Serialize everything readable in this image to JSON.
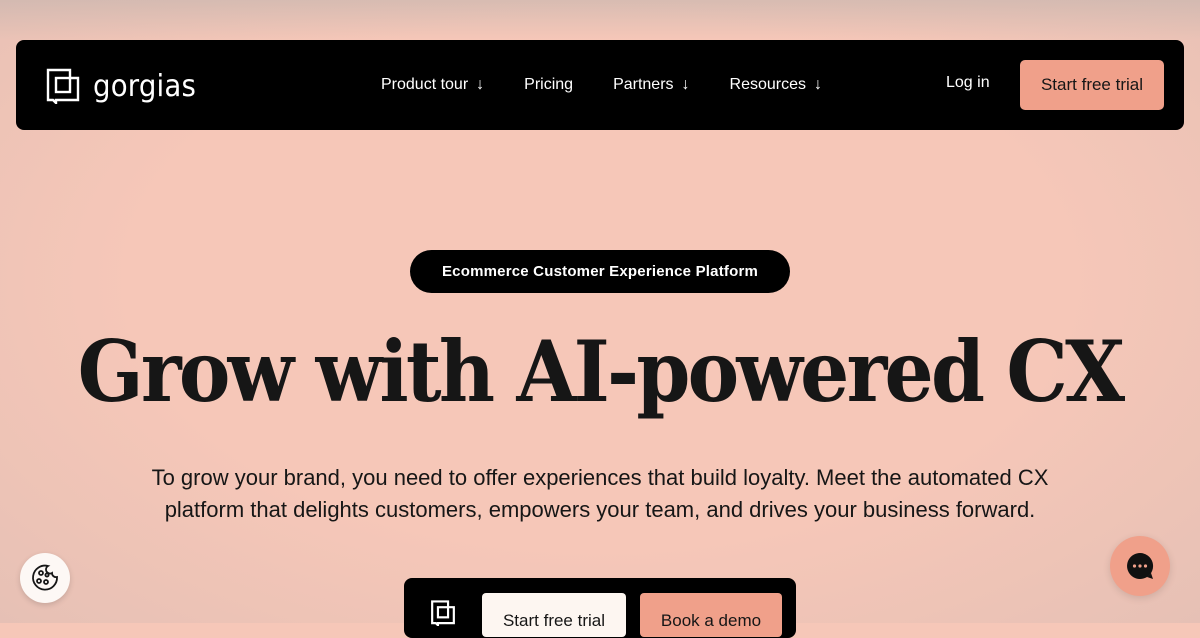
{
  "nav": {
    "logo_text": "gorgias",
    "logo_icon": "gorgias-logo-icon",
    "menu": [
      {
        "label": "Product tour",
        "has_dropdown": true
      },
      {
        "label": "Pricing",
        "has_dropdown": false
      },
      {
        "label": "Partners",
        "has_dropdown": true
      },
      {
        "label": "Resources",
        "has_dropdown": true
      }
    ],
    "dropdown_arrow": "↓",
    "login_label": "Log in",
    "cta_label": "Start free trial"
  },
  "hero": {
    "pill": "Ecommerce Customer Experience Platform",
    "headline": "Grow with AI-powered CX",
    "sub_line1": "To grow your brand, you need to offer experiences that build loyalty. Meet the automated CX",
    "sub_line2": "platform that delights customers, empowers your team, and drives your business forward."
  },
  "cta_bar": {
    "trial_label": "Start free trial",
    "demo_label": "Book a demo"
  },
  "floating": {
    "cookie_icon": "cookie-icon",
    "chat_icon": "chat-icon"
  },
  "colors": {
    "background": "#F6C7B8",
    "accent": "#F0A08A",
    "dark": "#000000",
    "light_button": "#FDF6F1"
  }
}
